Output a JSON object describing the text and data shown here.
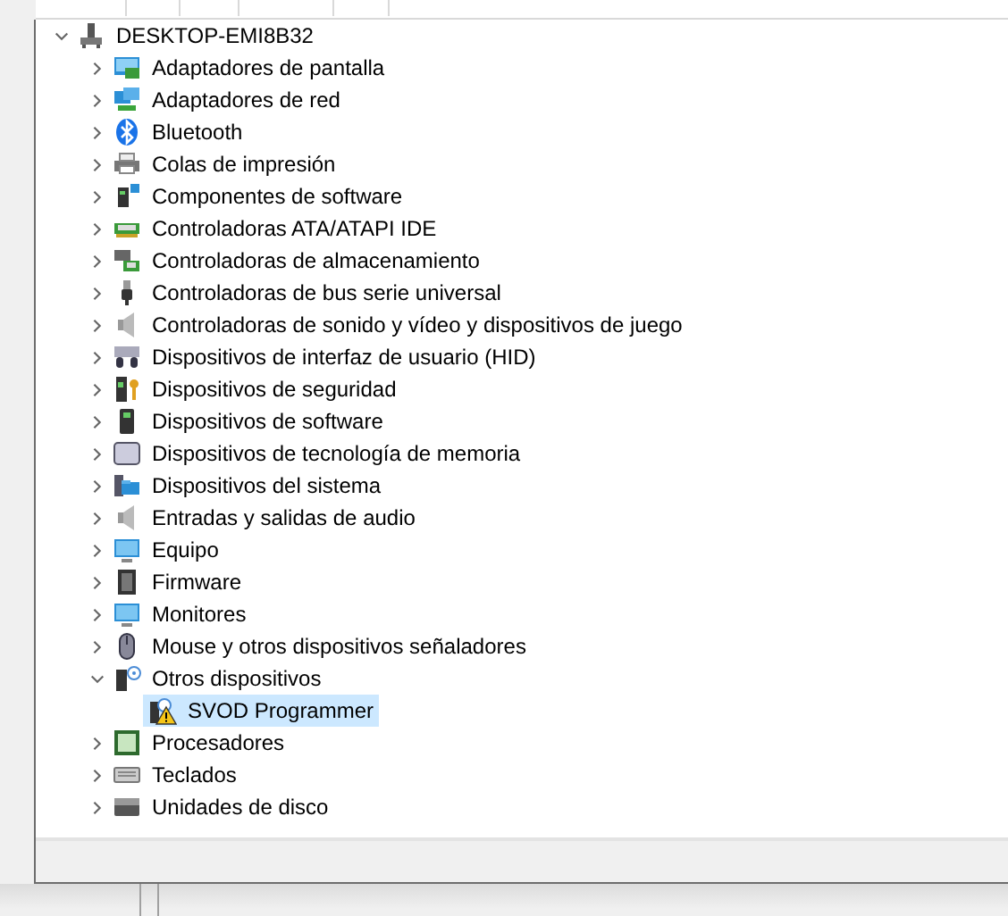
{
  "tree": [
    {
      "name": "DESKTOP-EMI8B32",
      "kind": "pc",
      "expanded": true,
      "selected": false,
      "children": [
        {
          "name": "Adaptadores de pantalla",
          "kind": "display",
          "expanded": false,
          "selected": false
        },
        {
          "name": "Adaptadores de red",
          "kind": "network",
          "expanded": false,
          "selected": false
        },
        {
          "name": "Bluetooth",
          "kind": "bluetooth",
          "expanded": false,
          "selected": false
        },
        {
          "name": "Colas de impresión",
          "kind": "printer",
          "expanded": false,
          "selected": false
        },
        {
          "name": "Componentes de software",
          "kind": "component",
          "expanded": false,
          "selected": false
        },
        {
          "name": "Controladoras ATA/ATAPI IDE",
          "kind": "card",
          "expanded": false,
          "selected": false
        },
        {
          "name": "Controladoras de almacenamiento",
          "kind": "storage",
          "expanded": false,
          "selected": false
        },
        {
          "name": "Controladoras de bus serie universal",
          "kind": "usb",
          "expanded": false,
          "selected": false
        },
        {
          "name": "Controladoras de sonido y vídeo y dispositivos de juego",
          "kind": "speaker",
          "expanded": false,
          "selected": false
        },
        {
          "name": "Dispositivos de interfaz de usuario (HID)",
          "kind": "hid",
          "expanded": false,
          "selected": false
        },
        {
          "name": "Dispositivos de seguridad",
          "kind": "security",
          "expanded": false,
          "selected": false
        },
        {
          "name": "Dispositivos de software",
          "kind": "tower",
          "expanded": false,
          "selected": false
        },
        {
          "name": "Dispositivos de tecnología de memoria",
          "kind": "memory",
          "expanded": false,
          "selected": false
        },
        {
          "name": "Dispositivos del sistema",
          "kind": "system",
          "expanded": false,
          "selected": false
        },
        {
          "name": "Entradas y salidas de audio",
          "kind": "speaker",
          "expanded": false,
          "selected": false
        },
        {
          "name": "Equipo",
          "kind": "monitor",
          "expanded": false,
          "selected": false
        },
        {
          "name": "Firmware",
          "kind": "chip",
          "expanded": false,
          "selected": false
        },
        {
          "name": "Monitores",
          "kind": "monitor",
          "expanded": false,
          "selected": false
        },
        {
          "name": "Mouse y otros dispositivos señaladores",
          "kind": "mouse",
          "expanded": false,
          "selected": false
        },
        {
          "name": "Otros dispositivos",
          "kind": "unknown",
          "expanded": true,
          "selected": false,
          "children": [
            {
              "name": "SVOD Programmer",
              "kind": "warning",
              "selected": true
            }
          ]
        },
        {
          "name": "Procesadores",
          "kind": "processor",
          "expanded": false,
          "selected": false
        },
        {
          "name": "Teclados",
          "kind": "keyboard",
          "expanded": false,
          "selected": false
        },
        {
          "name": "Unidades de disco",
          "kind": "disk",
          "expanded": false,
          "selected": false
        }
      ]
    }
  ]
}
